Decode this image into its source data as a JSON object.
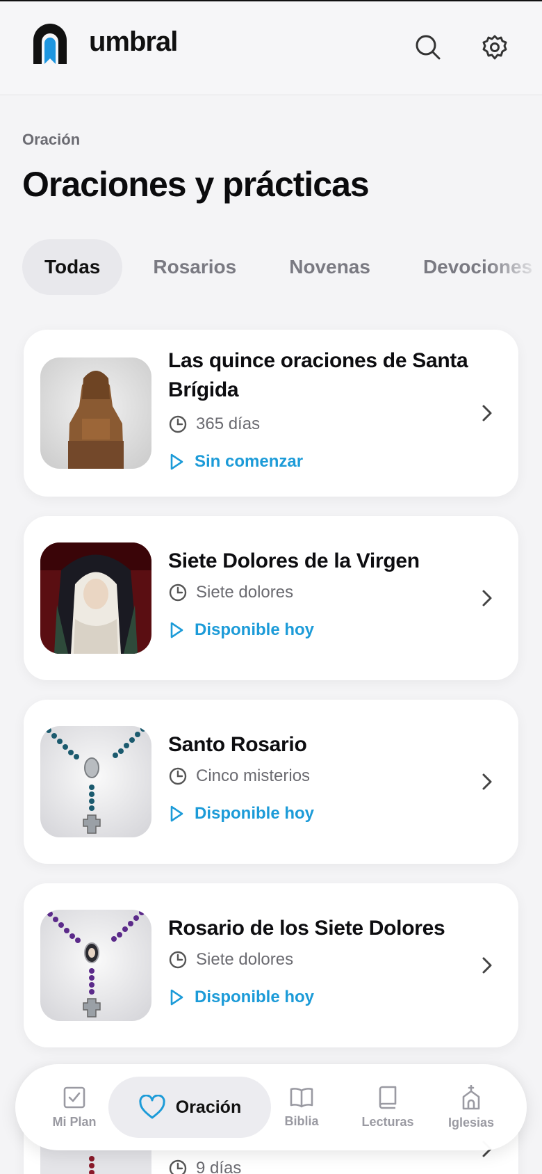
{
  "app": {
    "name": "umbral"
  },
  "header": {
    "search_icon": "search-icon",
    "settings_icon": "gear-icon"
  },
  "page": {
    "section": "Oración",
    "title": "Oraciones y prácticas"
  },
  "tabs": [
    {
      "label": "Todas",
      "active": true
    },
    {
      "label": "Rosarios",
      "active": false
    },
    {
      "label": "Novenas",
      "active": false
    },
    {
      "label": "Devociones",
      "active": false
    }
  ],
  "colors": {
    "accent": "#1c9bd8",
    "brand_blue": "#1e96e0",
    "text": "#111111",
    "muted": "#6a6a70"
  },
  "cards": [
    {
      "title": "Las quince oraciones de Santa Brígida",
      "meta": "365 días",
      "status": "Sin comenzar",
      "thumb": "saint-statue-image"
    },
    {
      "title": "Siete Dolores de la Virgen",
      "meta": "Siete dolores",
      "status": "Disponible hoy",
      "thumb": "virgin-image"
    },
    {
      "title": "Santo Rosario",
      "meta": "Cinco misterios",
      "status": "Disponible hoy",
      "thumb": "blue-rosary-image"
    },
    {
      "title": "Rosario de los Siete Dolores",
      "meta": "Siete dolores",
      "status": "Disponible hoy",
      "thumb": "purple-rosary-image"
    },
    {
      "title": "",
      "meta": "9 días",
      "status": "",
      "thumb": "red-rosary-image"
    }
  ],
  "nav": {
    "items": [
      {
        "label": "Mi Plan",
        "icon": "checkbox-icon"
      },
      {
        "label": "Oración",
        "icon": "heart-icon",
        "active": true
      },
      {
        "label": "Biblia",
        "icon": "open-book-icon"
      },
      {
        "label": "Lecturas",
        "icon": "book-icon"
      },
      {
        "label": "Iglesias",
        "icon": "church-icon"
      }
    ]
  }
}
